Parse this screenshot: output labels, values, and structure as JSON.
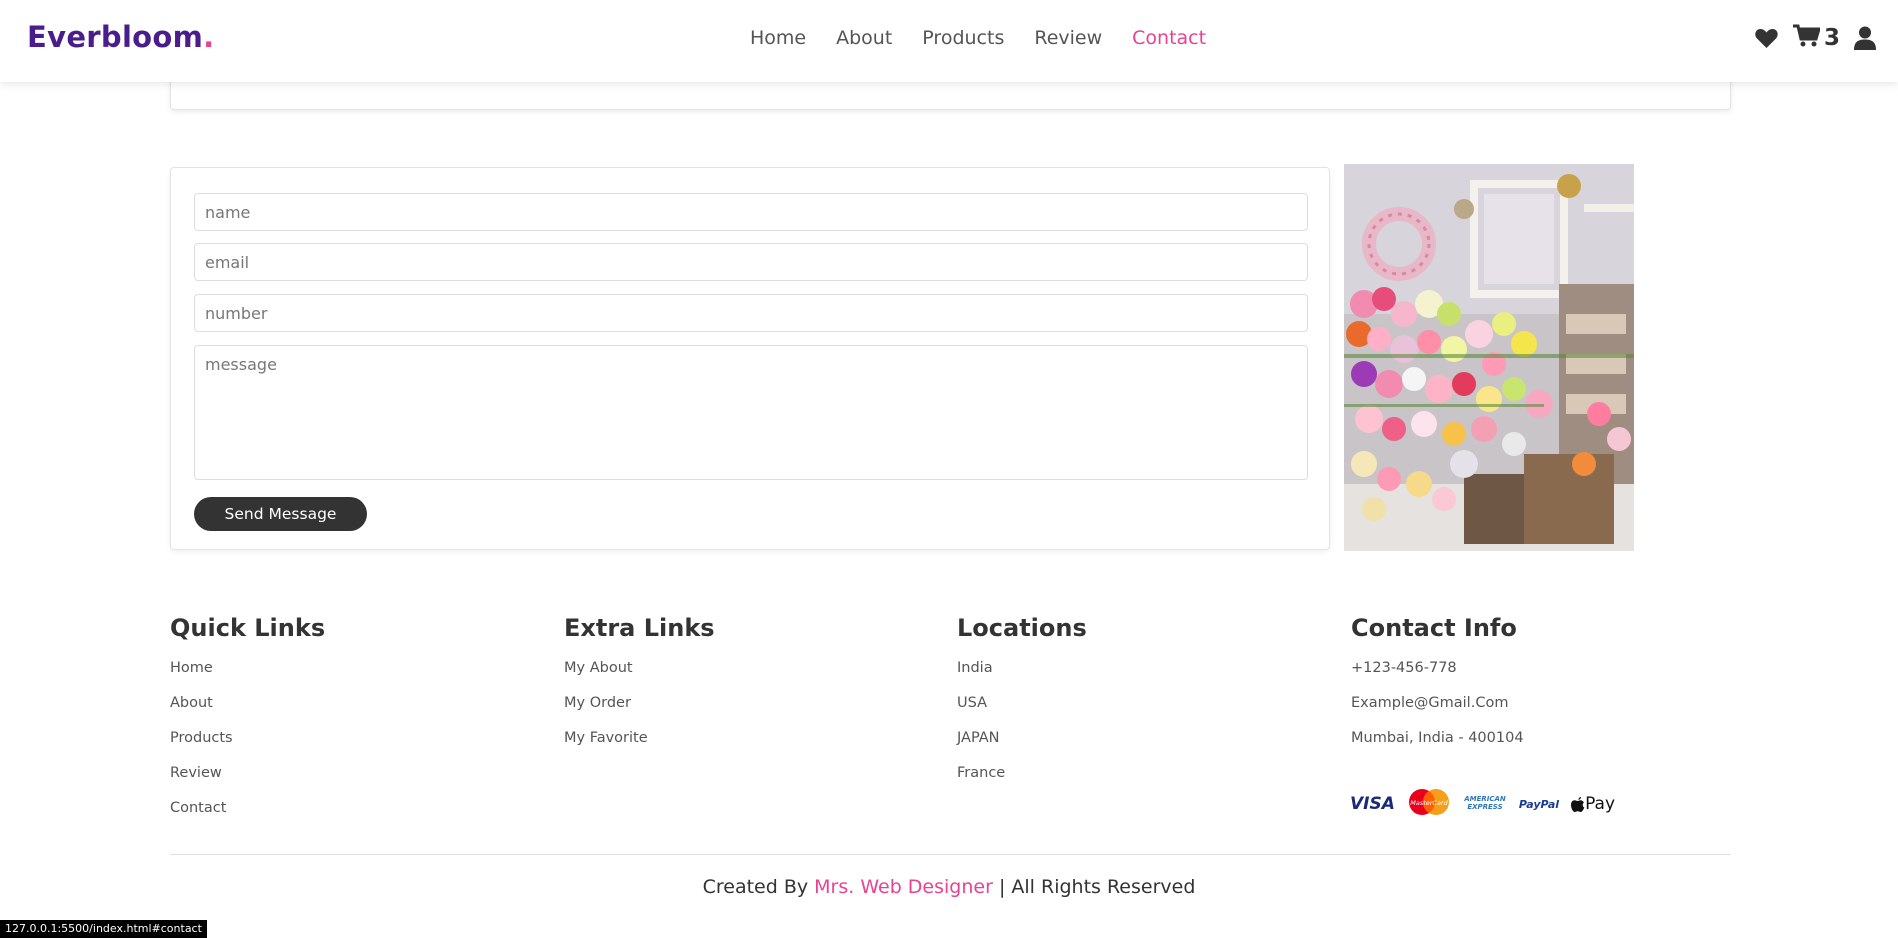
{
  "header": {
    "logo_text": "Everbloom",
    "logo_dot": ".",
    "nav": [
      {
        "label": "Home",
        "active": false
      },
      {
        "label": "About",
        "active": false
      },
      {
        "label": "Products",
        "active": false
      },
      {
        "label": "Review",
        "active": false
      },
      {
        "label": "Contact",
        "active": true
      }
    ],
    "icons": [
      "heart-icon",
      "cart-icon",
      "user-icon"
    ],
    "cart_count": "3"
  },
  "contact_form": {
    "name_placeholder": "name",
    "email_placeholder": "email",
    "number_placeholder": "number",
    "message_placeholder": "message",
    "send_label": "Send Message"
  },
  "footer": {
    "quick_links": {
      "title": "Quick Links",
      "items": [
        "Home",
        "About",
        "Products",
        "Review",
        "Contact"
      ]
    },
    "extra_links": {
      "title": "Extra Links",
      "items": [
        "My About",
        "My Order",
        "My Favorite"
      ]
    },
    "locations": {
      "title": "Locations",
      "items": [
        "India",
        "USA",
        "JAPAN",
        "France"
      ]
    },
    "contact_info": {
      "title": "Contact Info",
      "items": [
        "+123-456-778",
        "Example@Gmail.Com",
        "Mumbai, India - 400104"
      ]
    },
    "payments": [
      "VISA",
      "MasterCard",
      "AMERICAN EXPRESS",
      "PayPal",
      "Pay"
    ],
    "credit_prefix": "Created By",
    "credit_brand": "Mrs. Web Designer",
    "credit_suffix": "| All Rights Reserved"
  },
  "status_bar": "127.0.0.1:5500/index.html#contact",
  "colors": {
    "brand_purple": "#4b1d8c",
    "accent_pink": "#e84393",
    "dark": "#333333"
  }
}
